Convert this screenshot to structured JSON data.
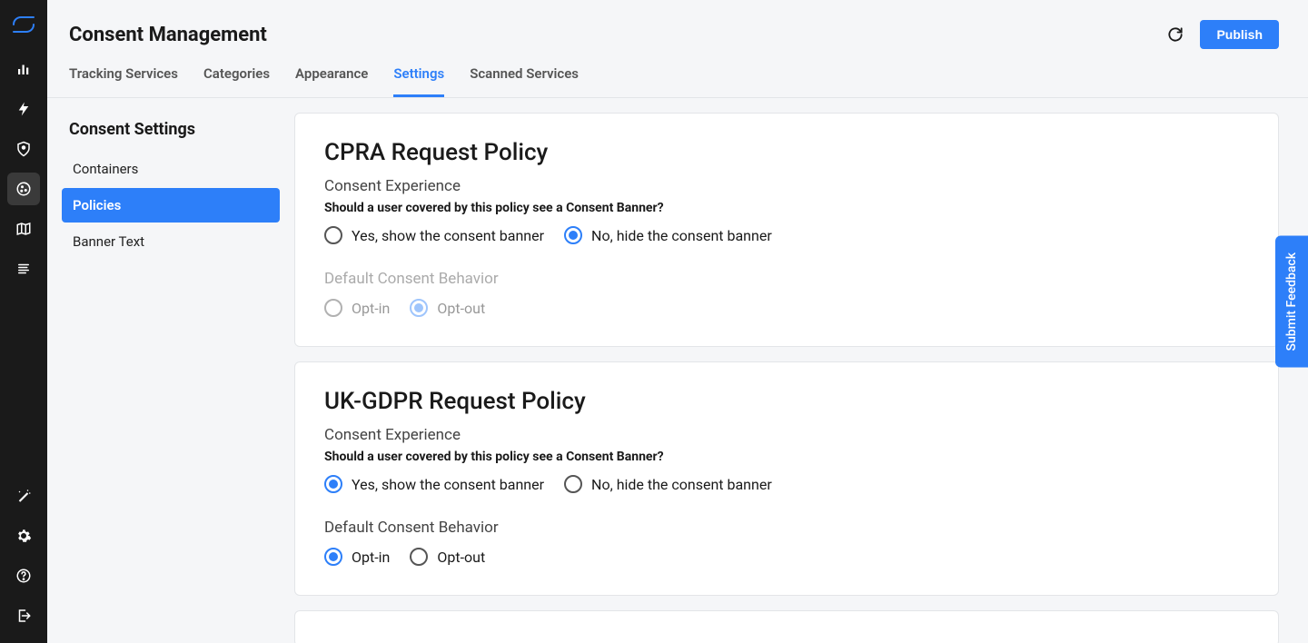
{
  "header": {
    "title": "Consent Management",
    "publish_label": "Publish"
  },
  "tabs": [
    {
      "label": "Tracking Services",
      "active": false
    },
    {
      "label": "Categories",
      "active": false
    },
    {
      "label": "Appearance",
      "active": false
    },
    {
      "label": "Settings",
      "active": true
    },
    {
      "label": "Scanned Services",
      "active": false
    }
  ],
  "sidebar": {
    "heading": "Consent Settings",
    "items": [
      {
        "label": "Containers",
        "active": false
      },
      {
        "label": "Policies",
        "active": true
      },
      {
        "label": "Banner Text",
        "active": false
      }
    ]
  },
  "feedback_label": "Submit Feedback",
  "policies": [
    {
      "title": "CPRA Request Policy",
      "experience_label": "Consent Experience",
      "banner_question": "Should a user covered by this policy see a Consent Banner?",
      "banner_yes_label": "Yes, show the consent banner",
      "banner_no_label": "No, hide the consent banner",
      "banner_choice": "no",
      "behavior_label": "Default Consent Behavior",
      "behavior_optin_label": "Opt-in",
      "behavior_optout_label": "Opt-out",
      "behavior_choice": "optout",
      "behavior_disabled": true
    },
    {
      "title": "UK-GDPR Request Policy",
      "experience_label": "Consent Experience",
      "banner_question": "Should a user covered by this policy see a Consent Banner?",
      "banner_yes_label": "Yes, show the consent banner",
      "banner_no_label": "No, hide the consent banner",
      "banner_choice": "yes",
      "behavior_label": "Default Consent Behavior",
      "behavior_optin_label": "Opt-in",
      "behavior_optout_label": "Opt-out",
      "behavior_choice": "optin",
      "behavior_disabled": false
    }
  ]
}
